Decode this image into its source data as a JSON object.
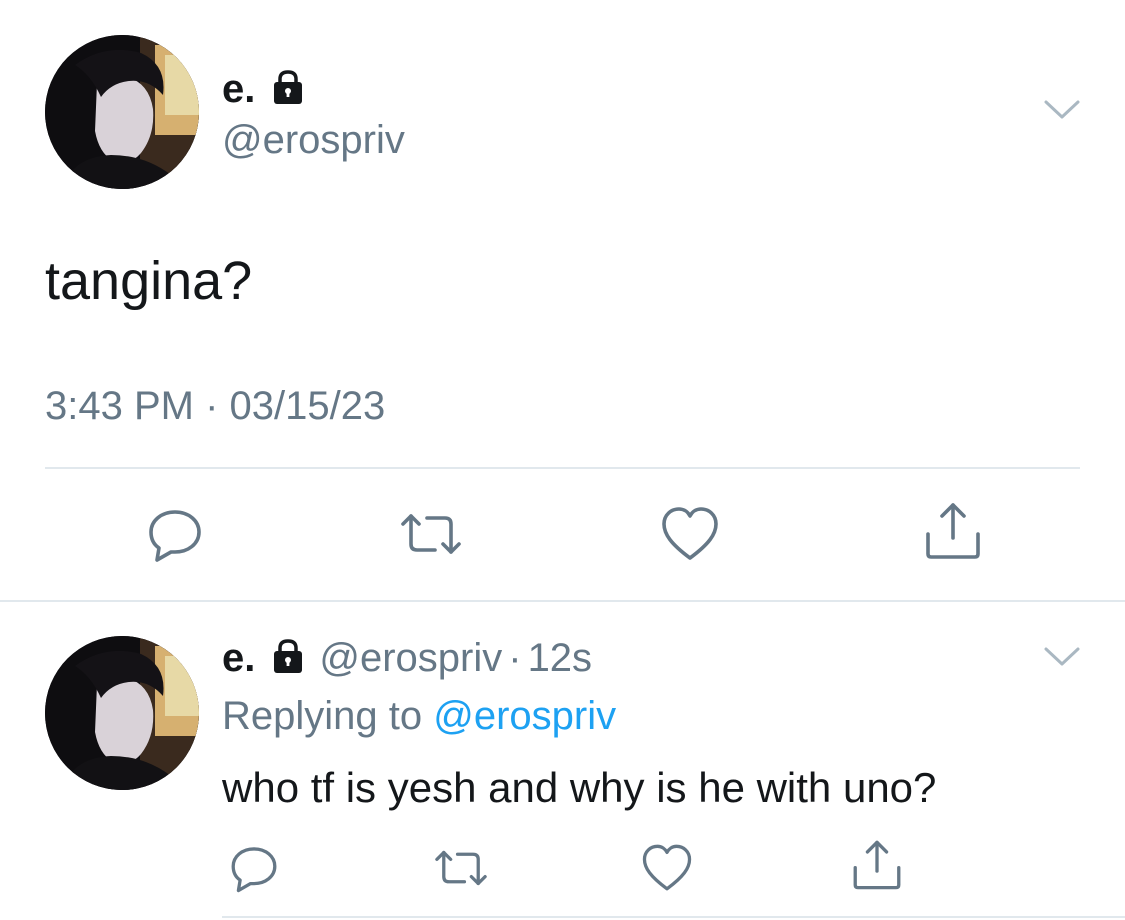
{
  "main_tweet": {
    "display_name": "e.",
    "handle": "@erospriv",
    "text": "tangina?",
    "timestamp": "3:43 PM · 03/15/23",
    "icons": {
      "lock": "lock-icon",
      "menu": "chevron-down-icon",
      "reply": "reply-icon",
      "retweet": "retweet-icon",
      "like": "heart-icon",
      "share": "share-icon"
    }
  },
  "reply_tweet": {
    "display_name": "e.",
    "handle": "@erospriv",
    "separator": "·",
    "time_ago": "12s",
    "replying_label": "Replying to",
    "replying_handle": "@erospriv",
    "text": "who tf is yesh and why is he with uno?"
  },
  "colors": {
    "text_primary": "#14171a",
    "text_secondary": "#657786",
    "link": "#1da1f2",
    "divider": "#e1e8ed",
    "icon": "#657786"
  }
}
